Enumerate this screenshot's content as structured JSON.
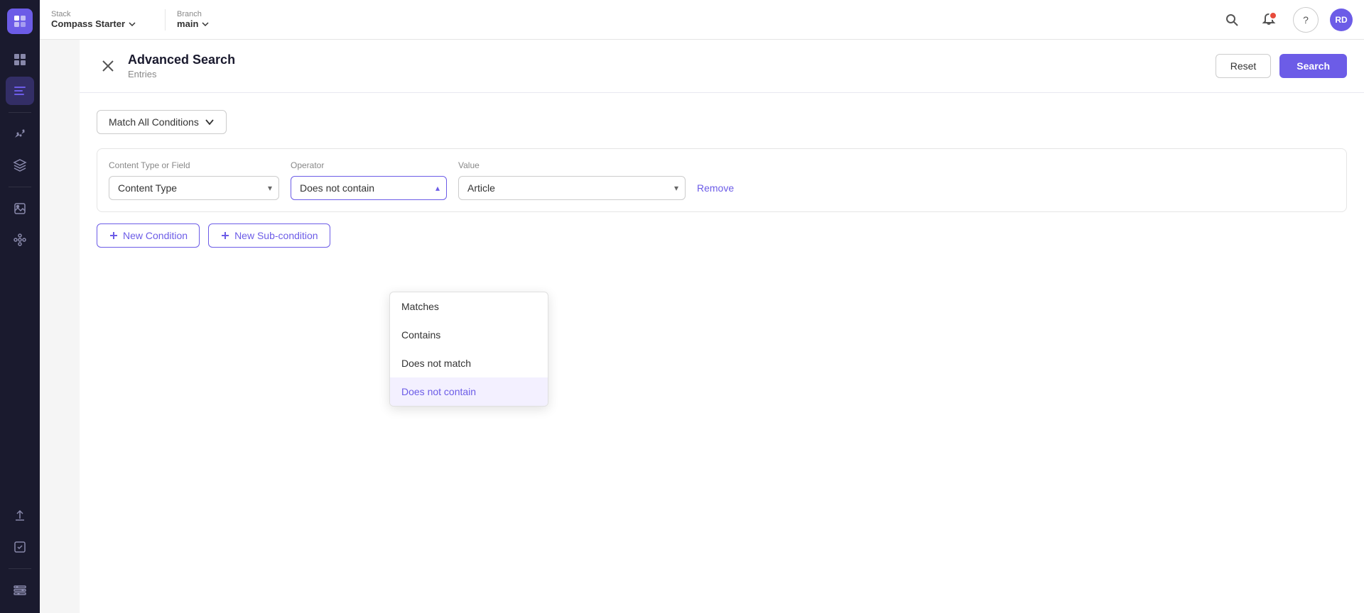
{
  "app": {
    "logo_text": "≡",
    "stack_label": "Stack",
    "stack_name": "Compass Starter",
    "branch_label": "Branch",
    "branch_name": "main"
  },
  "nav_icons": {
    "search": "🔍",
    "notification": "🔔",
    "help": "?",
    "avatar": "RD"
  },
  "sidebar": {
    "items": [
      {
        "name": "dashboard",
        "icon": "⊞"
      },
      {
        "name": "entries",
        "icon": "☰"
      },
      {
        "name": "analytics",
        "icon": "⊹"
      },
      {
        "name": "layers",
        "icon": "◫"
      },
      {
        "name": "assets",
        "icon": "◻"
      },
      {
        "name": "extensions",
        "icon": "⠿"
      },
      {
        "name": "deploy",
        "icon": "↑"
      },
      {
        "name": "tasks",
        "icon": "☑"
      },
      {
        "name": "settings",
        "icon": "⊟"
      }
    ]
  },
  "advanced_search": {
    "title": "Advanced Search",
    "subtitle": "Entries",
    "reset_label": "Reset",
    "search_label": "Search"
  },
  "match_conditions": {
    "label": "Match All Conditions"
  },
  "condition": {
    "header_ct": "Content Type or Field",
    "header_op": "Operator",
    "header_val": "Value",
    "ct_value": "Content Type",
    "op_value": "Does not contain",
    "val_value": "Article",
    "remove_label": "Remove"
  },
  "operator_options": [
    {
      "label": "Matches",
      "value": "matches"
    },
    {
      "label": "Contains",
      "value": "contains"
    },
    {
      "label": "Does not match",
      "value": "does_not_match"
    },
    {
      "label": "Does not contain",
      "value": "does_not_contain"
    }
  ],
  "buttons": {
    "new_condition": "+ New Condition",
    "new_sub_condition": "+ New Sub-condition"
  }
}
